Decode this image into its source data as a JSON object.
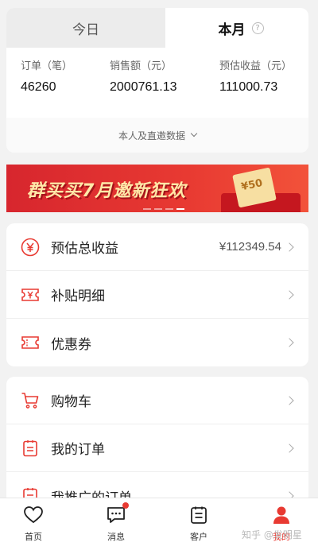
{
  "tabs": {
    "today": "今日",
    "month": "本月",
    "help_icon": "?"
  },
  "stats": {
    "orders_label": "订单（笔）",
    "orders_value": "46260",
    "sales_label": "销售额（元）",
    "sales_value": "2000761.13",
    "earnings_label": "预估收益（元）",
    "earnings_value": "111000.73"
  },
  "stats_footer": "本人及直邀数据",
  "banner": {
    "title": "群买买7月邀新狂欢",
    "ticket_value": "¥50"
  },
  "menu_group1": [
    {
      "label": "预估总收益",
      "value": "¥112349.54",
      "icon": "yen-circle-icon"
    },
    {
      "label": "补贴明细",
      "value": "",
      "icon": "yen-ticket-icon"
    },
    {
      "label": "优惠券",
      "value": "",
      "icon": "coupon-icon"
    }
  ],
  "menu_group2": [
    {
      "label": "购物车",
      "icon": "cart-icon"
    },
    {
      "label": "我的订单",
      "icon": "order-icon"
    },
    {
      "label": "我推广的订单",
      "icon": "promo-order-icon"
    }
  ],
  "nav": [
    {
      "label": "首页",
      "icon": "heart-icon"
    },
    {
      "label": "消息",
      "icon": "message-icon"
    },
    {
      "label": "客户",
      "icon": "customer-icon"
    },
    {
      "label": "我的",
      "icon": "user-icon"
    }
  ],
  "watermark": "知乎 @发明星",
  "colors": {
    "accent": "#e83a32",
    "background": "#f2f2f2"
  }
}
